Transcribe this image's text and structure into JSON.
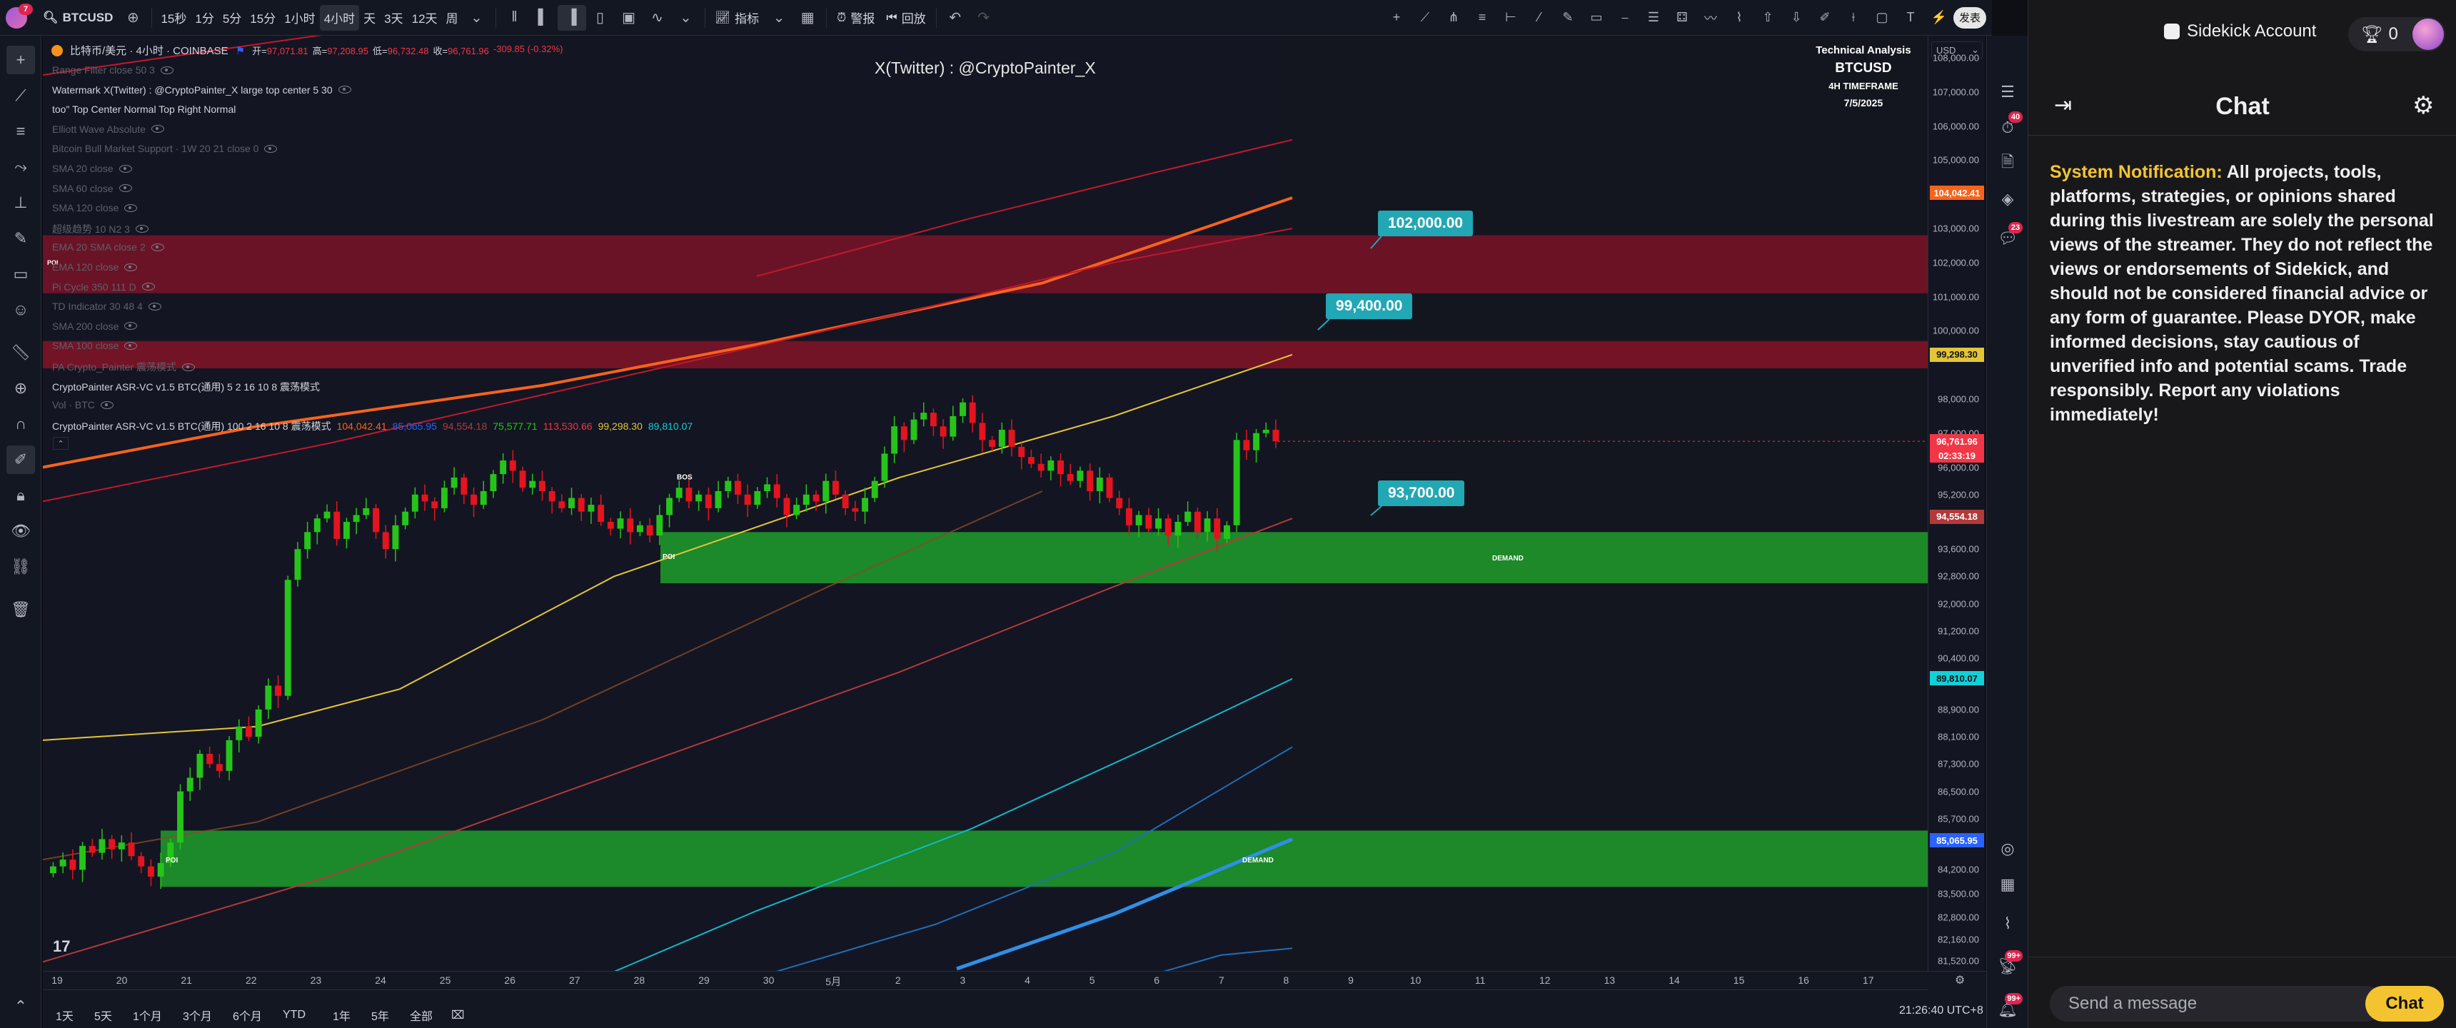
{
  "topbar": {
    "symbol": "BTCUSD",
    "intervals": [
      "15秒",
      "1分",
      "5分",
      "15分",
      "1小时",
      "4小时",
      "天",
      "3天",
      "12天",
      "周"
    ],
    "active_interval": "4小时",
    "indicators_label": "指标",
    "alert_label": "警报",
    "replay_label": "回放",
    "publish_label": "发表",
    "avatar_badge": "7"
  },
  "chart_header": {
    "title": "比特币/美元 · 4小时 · COINBASE",
    "ohlc": [
      {
        "label": "开=",
        "value": "97,071.81"
      },
      {
        "label": "高=",
        "value": "97,208.95"
      },
      {
        "label": "低=",
        "value": "96,732.48"
      },
      {
        "label": "收=",
        "value": "96,761.96"
      },
      {
        "label": "",
        "value": "-309.85 (-0.32%)"
      }
    ]
  },
  "legend": [
    "Range Filter close 50 3",
    "Watermark X(Twitter) : @CryptoPainter_X large top center 5 30",
    "too\" Top Center Normal Top Right Normal",
    "Elliott Wave Absolute",
    "Bitcoin Bull Market Support · 1W 20 21 close 0",
    "SMA 20 close",
    "SMA 60 close",
    "SMA 120 close",
    "超级趋势 10 N2 3",
    "EMA 20 SMA close 2",
    "EMA 120 close",
    "Pi Cycle 350 111 D",
    "TD Indicator 30 48 4",
    "SMA 200 close",
    "SMA 100 close",
    "PA Crypto_Painter 震荡模式",
    "CryptoPainter ASR-VC v1.5 BTC(通用) 5 2 16 10 8 震荡模式",
    "Vol · BTC",
    "CryptoPainter ASR-VC v1.5 BTC(通用) 100 2 16 10 8 震荡模式"
  ],
  "legend_values": [
    "104,042.41",
    "85,065.95",
    "94,554.18",
    "75,577.71",
    "113,530.66",
    "99,298.30",
    "89,810.07"
  ],
  "watermark": "X(Twitter) : @CryptoPainter_X",
  "ta_box": {
    "title": "Technical Analysis",
    "symbol": "BTCUSD",
    "timeframe": "4H TIMEFRAME",
    "date": "7/5/2025"
  },
  "callouts": [
    "102,000.00",
    "99,400.00",
    "93,700.00"
  ],
  "zones": {
    "demand_label": "DEMAND",
    "poi_label": "POI",
    "bos_label": "BOS"
  },
  "price_scale": {
    "currency": "USD",
    "labels": [
      "108,000.00",
      "107,000.00",
      "106,000.00",
      "105,000.00",
      "104,042.41",
      "103,000.00",
      "102,000.00",
      "101,000.00",
      "100,000.00",
      "99,298.30",
      "98,000.00",
      "97,000.00",
      "96,000.00",
      "95,200.00",
      "94,554.18",
      "93,600.00",
      "92,800.00",
      "92,000.00",
      "91,200.00",
      "90,400.00",
      "89,810.07",
      "88,900.00",
      "88,100.00",
      "87,300.00",
      "86,500.00",
      "85,700.00",
      "85,065.95",
      "84,200.00",
      "83,500.00",
      "82,800.00",
      "82,160.00",
      "81,520.00"
    ],
    "tags": [
      {
        "value": "104,042.41",
        "color": "#f7631b"
      },
      {
        "value": "99,298.30",
        "color": "#e3c53a"
      },
      {
        "value": "96,761.96",
        "color": "#f23645"
      },
      {
        "value": "02:33:19",
        "color": "#f23645"
      },
      {
        "value": "94,554.18",
        "color": "#b33a3a"
      },
      {
        "value": "89,810.07",
        "color": "#12d0d8"
      },
      {
        "value": "85,065.95",
        "color": "#2962ff"
      }
    ]
  },
  "time_axis": [
    "19",
    "20",
    "21",
    "22",
    "23",
    "24",
    "25",
    "26",
    "27",
    "28",
    "29",
    "30",
    "5月",
    "2",
    "3",
    "4",
    "5",
    "6",
    "7",
    "8",
    "9",
    "10",
    "11",
    "12",
    "13",
    "14",
    "15",
    "16",
    "17"
  ],
  "bottombar": {
    "ranges": [
      "1天",
      "5天",
      "1个月",
      "3个月",
      "6个月",
      "YTD",
      "1年",
      "5年",
      "全部"
    ],
    "clock": "21:26:40 UTC+8"
  },
  "right_badges": [
    "40",
    "23",
    "99+",
    "99+"
  ],
  "sidekick": {
    "account_label": "Sidekick Account",
    "points": "0",
    "chat_title": "Chat",
    "notification_prefix": "System Notification:",
    "notification_body": " All projects, tools, platforms, strategies, or opinions shared during this livestream are solely the personal views of the streamer. They do not reflect the views or endorsements of Sidekick, and should not be considered financial advice or any form of guarantee. Please DYOR, make informed decisions, stay cautious of unverified info and potential scams. Trade responsibly. Report any violations immediately!",
    "input_placeholder": "Send a message",
    "send_label": "Chat"
  },
  "colors": {
    "up": "#26c41a",
    "down": "#e4141f",
    "accent": "#22a7b5",
    "notice": "#f4c430",
    "send": "#f4c430"
  }
}
